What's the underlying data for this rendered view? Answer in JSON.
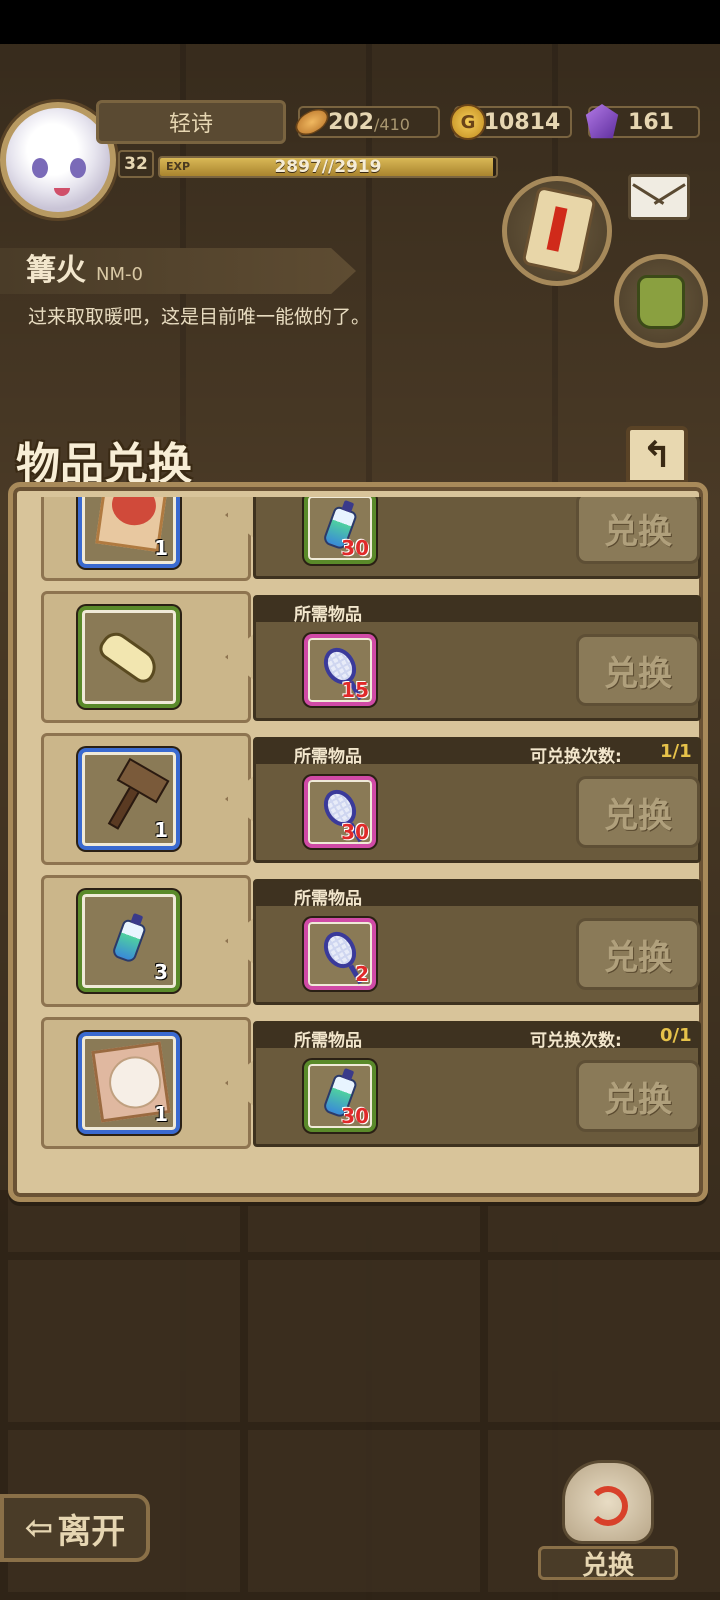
{
  "player": {
    "name": "轻诗",
    "level": "32",
    "exp_tag": "EXP",
    "exp_text": "2897//2919",
    "exp_fraction": 0.992
  },
  "resources": {
    "stamina_current": "202",
    "stamina_max": "/410",
    "gold": "10814",
    "gold_symbol": "G",
    "gems": "161"
  },
  "location": {
    "name": "篝火",
    "code": "NM-0",
    "description": "过来取取暖吧，这是目前唯一能做的了。"
  },
  "panel": {
    "title": "物品兑换",
    "back_glyph": "↰"
  },
  "rows": [
    {
      "reward_count": "1",
      "reward_icon": "portrait-red-hair-icon",
      "req_label": "",
      "limit_label": "",
      "limit_value": "",
      "req_icon": "potion-bottle-icon",
      "req_count": "30",
      "button": "兑换"
    },
    {
      "reward_count": "",
      "reward_icon": "shoe-insole-icon",
      "req_label": "所需物品",
      "limit_label": "",
      "limit_value": "",
      "req_icon": "racket-icon",
      "req_count": "15",
      "button": "兑换"
    },
    {
      "reward_count": "1",
      "reward_icon": "hammer-icon",
      "req_label": "所需物品",
      "limit_label": "可兑换次数:",
      "limit_value": "1/1",
      "req_icon": "racket-icon",
      "req_count": "30",
      "button": "兑换"
    },
    {
      "reward_count": "3",
      "reward_icon": "potion-bottle-icon",
      "req_label": "所需物品",
      "limit_label": "",
      "limit_value": "",
      "req_icon": "racket-icon",
      "req_count": "2",
      "button": "兑换"
    },
    {
      "reward_count": "1",
      "reward_icon": "portrait-white-hair-icon",
      "req_label": "所需物品",
      "limit_label": "可兑换次数:",
      "limit_value": "0/1",
      "req_icon": "potion-bottle-icon",
      "req_count": "30",
      "button": "兑换"
    }
  ],
  "bottom": {
    "leave_label": "离开",
    "leave_arrow": "⇦",
    "exchange_label": "兑换"
  },
  "colors": {
    "panel_bg": "#d8c49a",
    "rare_border": "#3a6ad0",
    "common_border": "#5a8a2a",
    "material_border": "#d04aa6",
    "limit_value": "#e6c24a",
    "req_count": "#e02a2a"
  }
}
